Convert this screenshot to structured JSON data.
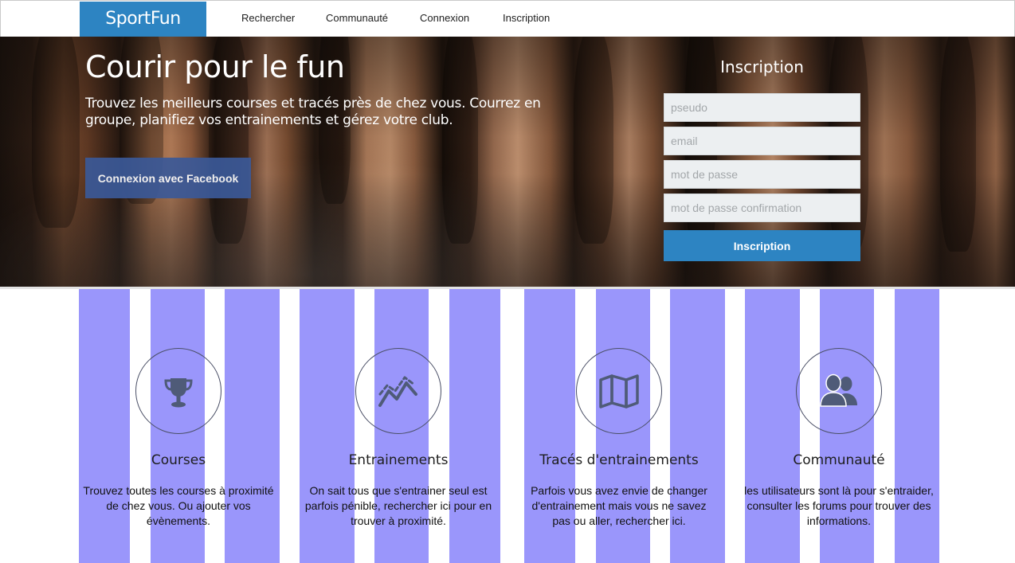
{
  "navbar": {
    "brand": "SportFun",
    "links": [
      {
        "label": "Rechercher"
      },
      {
        "label": "Communauté"
      },
      {
        "label": "Connexion"
      },
      {
        "label": "Inscription"
      }
    ]
  },
  "hero": {
    "title": "Courir pour le fun",
    "text": "Trouvez les meilleurs courses et tracés près de chez vous. Courrez en groupe, planifiez vos entrainements et gérez votre club.",
    "facebook_button": "Connexion avec Facebook"
  },
  "signup_form": {
    "title": "Inscription",
    "fields": [
      {
        "placeholder": "pseudo",
        "value": ""
      },
      {
        "placeholder": "email",
        "value": ""
      },
      {
        "placeholder": "mot de passe",
        "value": ""
      },
      {
        "placeholder": "mot de passe confirmation",
        "value": ""
      }
    ],
    "submit_label": "Inscription"
  },
  "features": [
    {
      "icon": "trophy-icon",
      "title": "Courses",
      "text": "Trouvez toutes les courses à proximité de chez vous. Ou ajouter vos évènements."
    },
    {
      "icon": "line-chart-icon",
      "title": "Entrainements",
      "text": "On sait tous que s'entrainer seul est parfois pénible, rechercher ici pour en trouver à proximité."
    },
    {
      "icon": "map-icon",
      "title": "Tracés d'entrainements",
      "text": "Parfois vous avez envie de changer d'entrainement mais vous ne savez pas ou aller, rechercher ici."
    },
    {
      "icon": "users-icon",
      "title": "Communauté",
      "text": "les utilisateurs sont là pour s'entraider, consulter les forums pour trouver des informations."
    }
  ],
  "colors": {
    "brand": "#2d84c2",
    "facebook": "#3b5998",
    "grid_overlay": "#9a96fb",
    "icon": "#4f5b78"
  }
}
